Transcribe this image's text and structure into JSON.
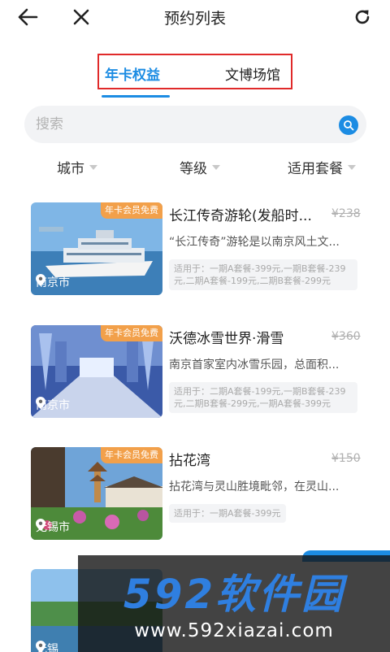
{
  "header": {
    "title": "预约列表",
    "back_icon": "back-arrow-icon",
    "close_icon": "close-icon",
    "refresh_icon": "refresh-icon"
  },
  "tabs": [
    {
      "label": "年卡权益",
      "active": true
    },
    {
      "label": "文博场馆",
      "active": false
    }
  ],
  "search": {
    "placeholder": "搜索",
    "value": ""
  },
  "filters": [
    {
      "label": "城市"
    },
    {
      "label": "等级"
    },
    {
      "label": "适用套餐"
    }
  ],
  "items": [
    {
      "badge": "年卡会员免费",
      "city": "南京市",
      "title": "长江传奇游轮(发船时...",
      "price": "¥238",
      "desc": "“长江传奇”游轮是以南京风土文...",
      "packages": [
        "适用于：一期A套餐-399元,一期B套餐-239",
        "元,二期A套餐-199元,二期B套餐-299元"
      ]
    },
    {
      "badge": "年卡会员免费",
      "city": "南京市",
      "title": "沃德冰雪世界·滑雪",
      "price": "¥360",
      "desc": "南京首家室内冰雪乐园，总面积...",
      "packages": [
        "适用于：二期A套餐-199元,一期B套餐-239",
        "元,二期B套餐-299元,一期A套餐-399元"
      ]
    },
    {
      "badge": "年卡会员免费",
      "city": "无锡市",
      "title": "拈花湾",
      "price": "¥150",
      "desc": "拈花湾与灵山胜境毗邻，在灵山...",
      "packages": [
        "适用于：一期A套餐-399元"
      ]
    },
    {
      "city": "无锡"
    }
  ],
  "watermark": {
    "logo": "592软件园",
    "url": "www.592xiazai.com"
  },
  "colors": {
    "accent": "#1c8ce3",
    "badge": "#f2a04a",
    "highlight_box": "#e02a2a"
  }
}
